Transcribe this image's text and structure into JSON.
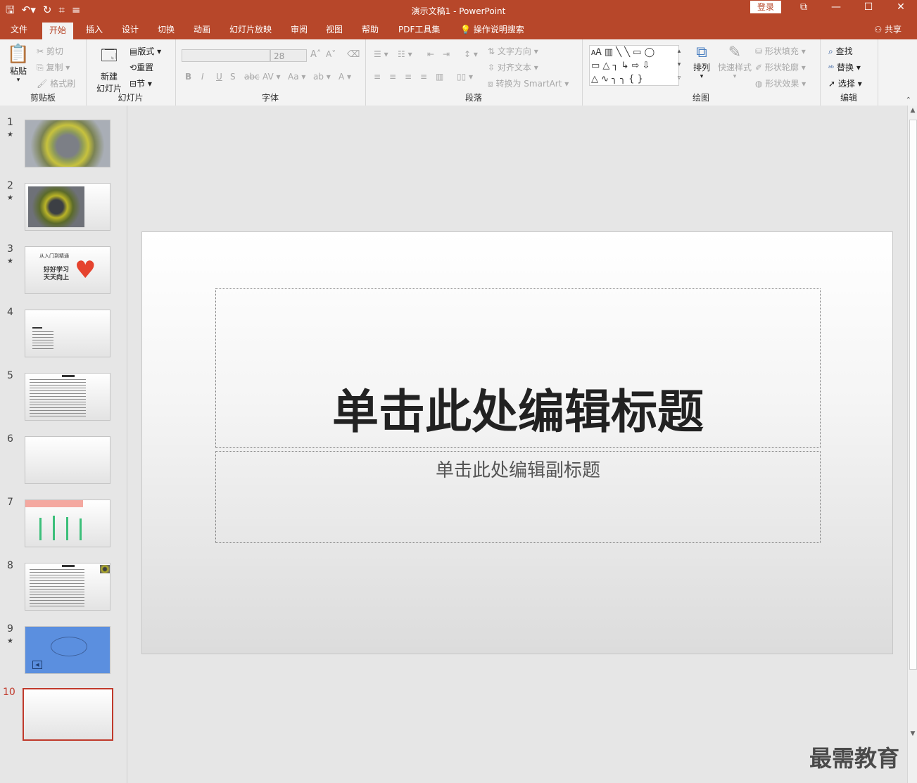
{
  "window": {
    "title": "演示文稿1  -  PowerPoint",
    "login": "登录"
  },
  "tabs": [
    "文件",
    "开始",
    "插入",
    "设计",
    "切换",
    "动画",
    "幻灯片放映",
    "审阅",
    "视图",
    "帮助",
    "PDF工具集"
  ],
  "tell_me": "操作说明搜索",
  "share": "共享",
  "ribbon": {
    "clipboard": {
      "label": "剪贴板",
      "paste": "粘贴",
      "cut": "剪切",
      "copy": "复制",
      "format_painter": "格式刷"
    },
    "slides": {
      "label": "幻灯片",
      "new_slide_line1": "新建",
      "new_slide_line2": "幻灯片",
      "layout": "版式",
      "reset": "重置",
      "section": "节"
    },
    "font": {
      "label": "字体",
      "font_name": "",
      "font_size": "28"
    },
    "paragraph": {
      "label": "段落",
      "text_direction": "文字方向",
      "align_text": "对齐文本",
      "smartart": "转换为 SmartArt"
    },
    "drawing": {
      "label": "绘图",
      "arrange": "排列",
      "quick_styles": "快速样式",
      "shape_fill": "形状填充",
      "shape_outline": "形状轮廓",
      "shape_effects": "形状效果"
    },
    "editing": {
      "label": "编辑",
      "find": "查找",
      "replace": "替换",
      "select": "选择"
    }
  },
  "slides": [
    {
      "num": "1",
      "star": "★"
    },
    {
      "num": "2",
      "star": "★"
    },
    {
      "num": "3",
      "star": "★",
      "text1": "从入门到精通",
      "text2": "好好学习",
      "text3": "天天向上"
    },
    {
      "num": "4",
      "star": ""
    },
    {
      "num": "5",
      "star": ""
    },
    {
      "num": "6",
      "star": ""
    },
    {
      "num": "7",
      "star": ""
    },
    {
      "num": "8",
      "star": ""
    },
    {
      "num": "9",
      "star": "★"
    },
    {
      "num": "10",
      "star": ""
    }
  ],
  "main_slide": {
    "title_placeholder": "单击此处编辑标题",
    "subtitle_placeholder": "单击此处编辑副标题"
  },
  "watermark": "最需教育",
  "colors": {
    "accent": "#b7472a",
    "selected_border": "#c0392b"
  }
}
